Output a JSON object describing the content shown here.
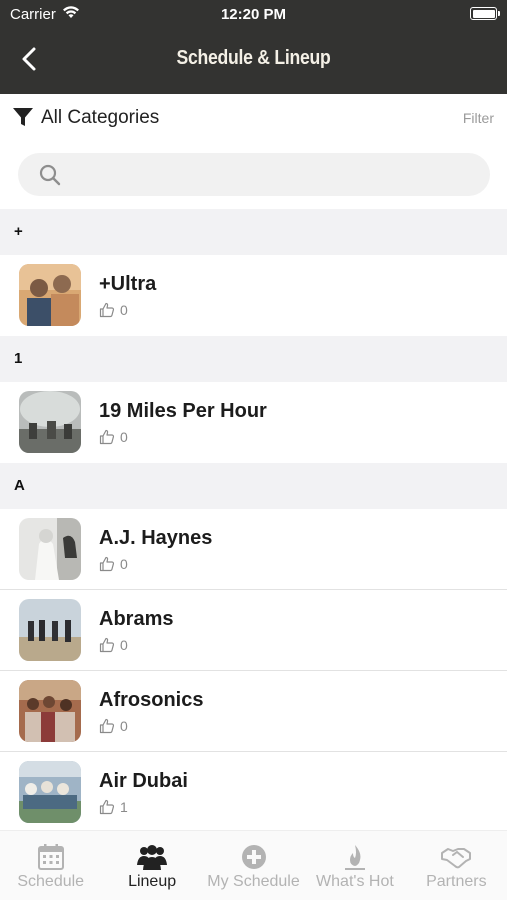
{
  "status_bar": {
    "carrier": "Carrier",
    "time": "12:20 PM"
  },
  "nav": {
    "title": "Schedule & Lineup",
    "back_icon": "chevron-left-icon"
  },
  "category": {
    "label": "All Categories",
    "filter_label": "Filter",
    "icon": "funnel-icon"
  },
  "search": {
    "placeholder": "",
    "value": "",
    "icon": "search-icon"
  },
  "sections": [
    {
      "header": "+",
      "items": [
        {
          "name": "+Ultra",
          "likes": "0"
        }
      ]
    },
    {
      "header": "1",
      "items": [
        {
          "name": "19 Miles Per Hour",
          "likes": "0"
        }
      ]
    },
    {
      "header": "A",
      "items": [
        {
          "name": "A.J. Haynes",
          "likes": "0"
        },
        {
          "name": "Abrams",
          "likes": "0"
        },
        {
          "name": "Afrosonics",
          "likes": "0"
        },
        {
          "name": "Air Dubai",
          "likes": "1"
        }
      ]
    }
  ],
  "tabs": [
    {
      "label": "Schedule",
      "icon": "calendar-icon",
      "active": false
    },
    {
      "label": "Lineup",
      "icon": "group-icon",
      "active": true
    },
    {
      "label": "My Schedule",
      "icon": "plus-circle-icon",
      "active": false
    },
    {
      "label": "What's Hot",
      "icon": "flame-icon",
      "active": false
    },
    {
      "label": "Partners",
      "icon": "handshake-icon",
      "active": false
    }
  ],
  "colors": {
    "nav_bg": "#333331",
    "section_bg": "#f2f2f4",
    "tab_inactive": "#b3b3b3",
    "tab_active": "#222222"
  }
}
